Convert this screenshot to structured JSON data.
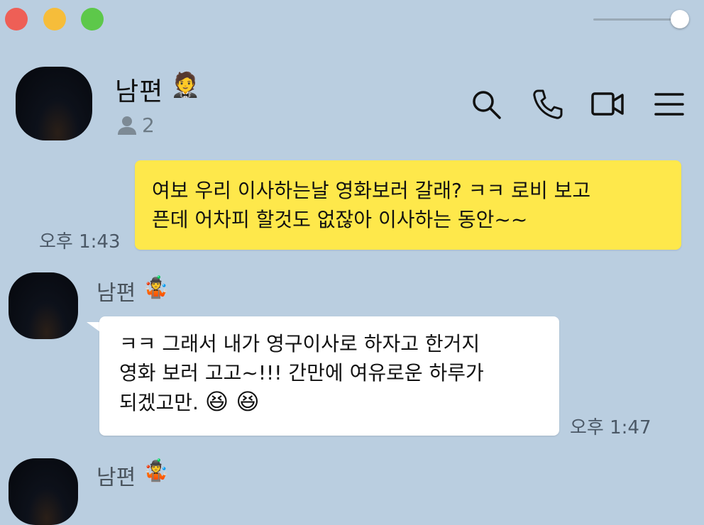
{
  "window": {
    "traffic_lights": [
      "close",
      "minimize",
      "zoom"
    ],
    "opacity_slider_level": 1.0
  },
  "header": {
    "chat_title": "남편",
    "title_emoji": "🤵",
    "member_count": "2",
    "icons": [
      "search-icon",
      "phone-icon",
      "video-call-icon",
      "menu-icon"
    ]
  },
  "messages": [
    {
      "from": "me",
      "text": "여보 우리 이사하는날 영화보러 갈래? ㅋㅋ 로비 보고\n픈데 어차피 할것도 없잖아 이사하는 동안~~",
      "time": "오후 1:43"
    },
    {
      "from": "them",
      "sender": "남편",
      "sender_emoji": "🤹",
      "text": "ㅋㅋ 그래서 내가 영구이사로 하자고 한거지\n영화 보러 고고~!!! 간만에 여유로운 하루가\n되겠고만.",
      "trailing_emojis": "😆 😆",
      "time": "오후 1:47"
    },
    {
      "from": "them",
      "sender": "남편",
      "sender_emoji": "🤹"
    }
  ],
  "colors": {
    "background": "#bacee0",
    "my_bubble": "#fee84b",
    "their_bubble": "#ffffff"
  }
}
